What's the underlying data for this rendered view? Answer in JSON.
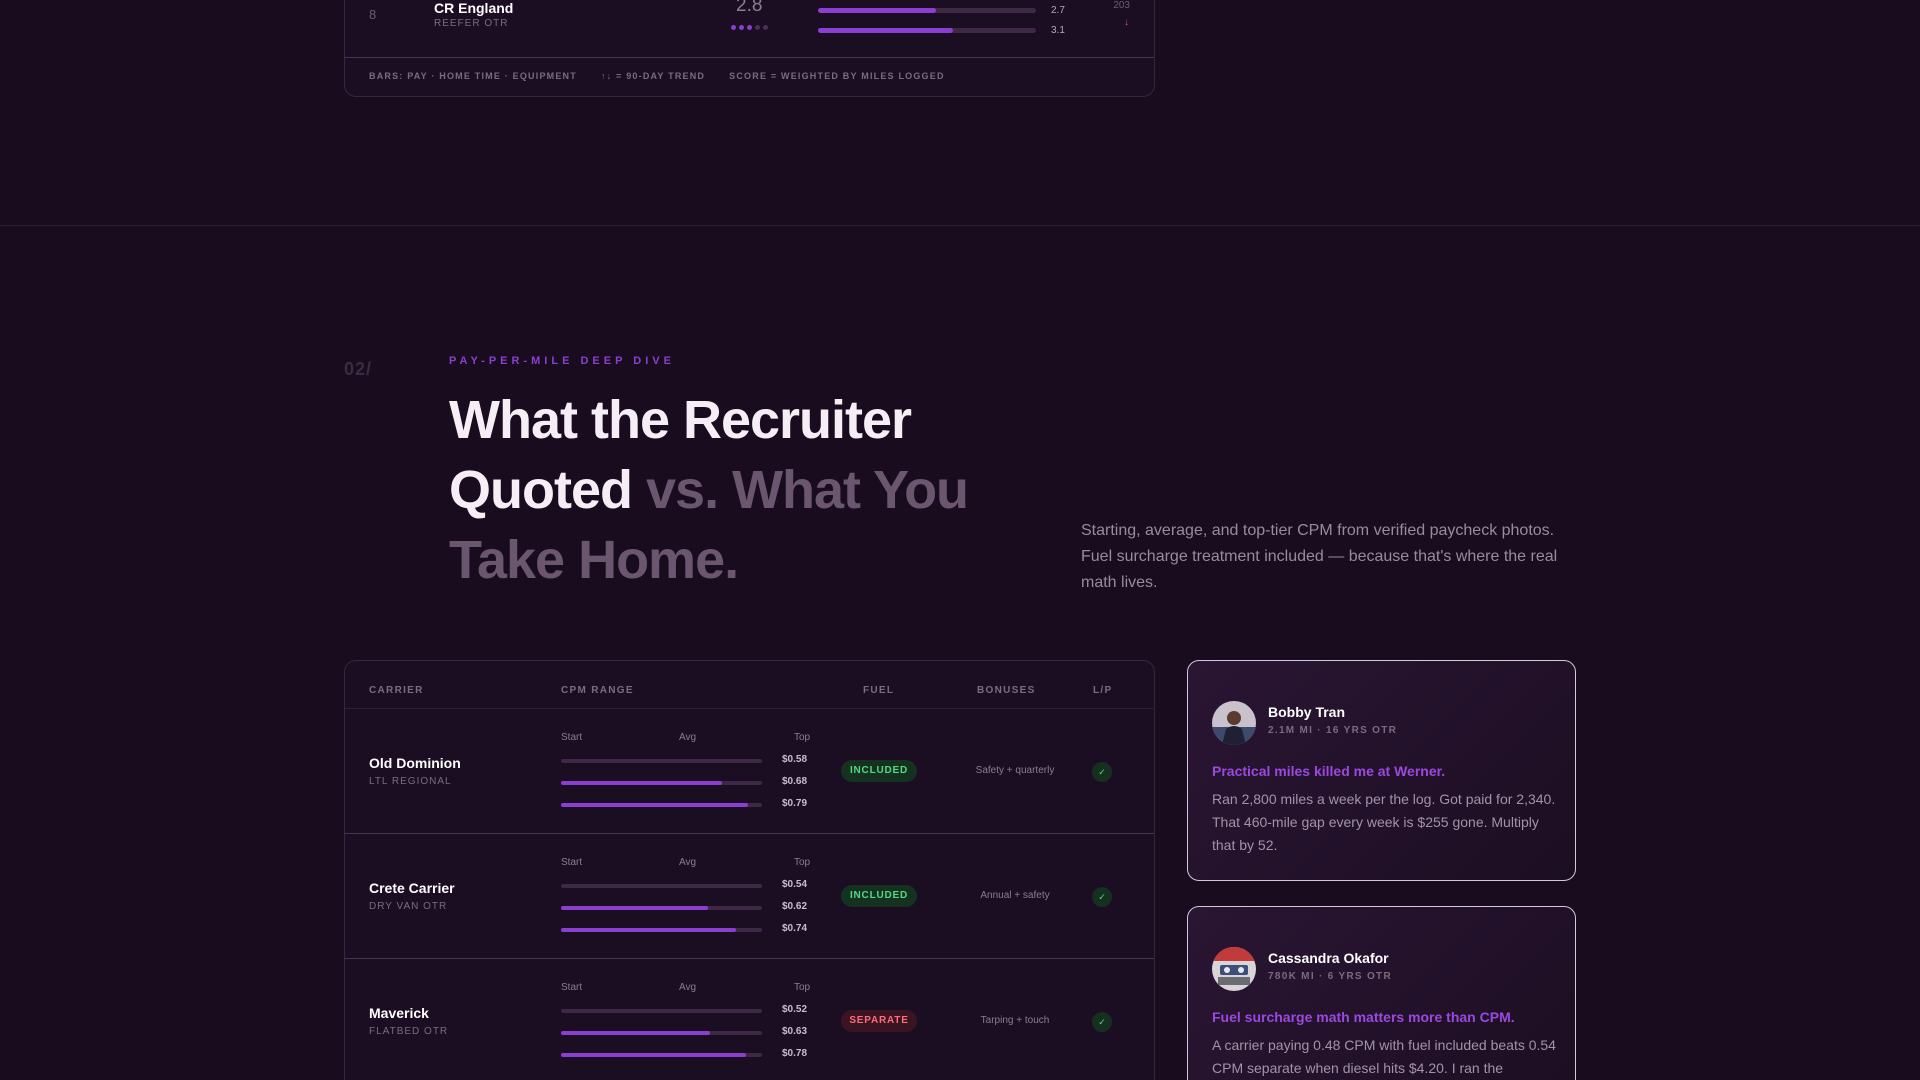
{
  "ranking": {
    "row": {
      "rank": "8",
      "name": "CR England",
      "type": "REEFER OTR",
      "score": "2.8",
      "score_dots": 3,
      "bars": [
        {
          "value": "2.7",
          "fraction": 0.54
        },
        {
          "value": "3.1",
          "fraction": 0.62
        }
      ],
      "miles": "203",
      "trend": "↓"
    },
    "legend": [
      "BARS: PAY · HOME TIME · EQUIPMENT",
      "↑↓ = 90-DAY TREND",
      "SCORE = WEIGHTED BY MILES LOGGED"
    ]
  },
  "section": {
    "number": "02/",
    "eyebrow": "PAY-PER-MILE DEEP DIVE",
    "title_strong": "What the Recruiter Quoted",
    "title_muted": "vs. What You Take Home.",
    "description": "Starting, average, and top-tier CPM from verified paycheck photos. Fuel surcharge treatment included — because that's where the real math lives."
  },
  "cpm_table": {
    "headers": {
      "carrier": "CARRIER",
      "cpm_range": "CPM RANGE",
      "fuel": "FUEL",
      "bonuses": "BONUSES",
      "lp": "L/P"
    },
    "mini_labels": {
      "start": "Start",
      "avg": "Avg",
      "top": "Top"
    },
    "rows": [
      {
        "name": "Old Dominion",
        "type": "LTL REGIONAL",
        "start": "$0.58",
        "avg": "$0.68",
        "top": "$0.79",
        "start_fill": 0.0,
        "avg_fill": 0.8,
        "top_fill": 0.93,
        "fuel": "INCLUDED",
        "fuel_status": "included",
        "bonus": "Safety + quarterly",
        "lp": "✓"
      },
      {
        "name": "Crete Carrier",
        "type": "DRY VAN OTR",
        "start": "$0.54",
        "avg": "$0.62",
        "top": "$0.74",
        "start_fill": 0.0,
        "avg_fill": 0.73,
        "top_fill": 0.87,
        "fuel": "INCLUDED",
        "fuel_status": "included",
        "bonus": "Annual + safety",
        "lp": "✓"
      },
      {
        "name": "Maverick",
        "type": "FLATBED OTR",
        "start": "$0.52",
        "avg": "$0.63",
        "top": "$0.78",
        "start_fill": 0.0,
        "avg_fill": 0.74,
        "top_fill": 0.92,
        "fuel": "SEPARATE",
        "fuel_status": "separate",
        "bonus": "Tarping + touch",
        "lp": "✓"
      }
    ]
  },
  "reviews": [
    {
      "name": "Bobby Tran",
      "meta": "2.1M MI · 16 YRS OTR",
      "title": "Practical miles killed me at Werner.",
      "body": "Ran 2,800 miles a week per the log. Got paid for 2,340. That 460-mile gap every week is $255 gone. Multiply that by 52."
    },
    {
      "name": "Cassandra Okafor",
      "meta": "780K MI · 6 YRS OTR",
      "title": "Fuel surcharge math matters more than CPM.",
      "body": "A carrier paying 0.48 CPM with fuel included beats 0.54 CPM separate when diesel hits $4.20. I ran the"
    }
  ],
  "colors": {
    "background": "#1a0c1f",
    "accent": "#8a3fd1",
    "included": "#54d982",
    "separate": "#ff6a7e"
  }
}
